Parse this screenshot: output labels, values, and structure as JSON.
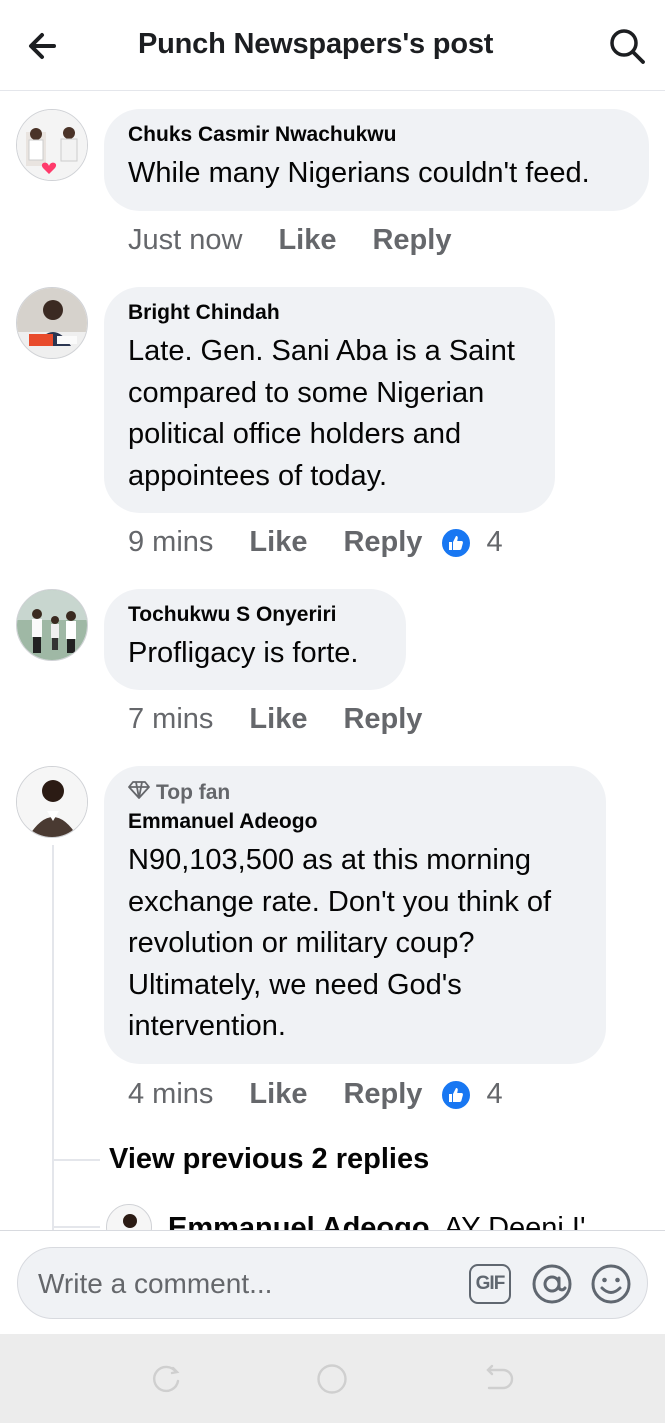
{
  "header": {
    "title": "Punch Newspapers's post",
    "back_icon": "arrow-left-icon",
    "search_icon": "search-icon"
  },
  "comments": [
    {
      "author": "Chuks Casmir Nwachukwu",
      "text": "While many Nigerians couldn't feed.",
      "time": "Just now",
      "like_label": "Like",
      "reply_label": "Reply"
    },
    {
      "author": "Bright Chindah",
      "text": "Late. Gen. Sani Aba is a Saint\ncompared to some Nigerian\npolitical office holders and\nappointees of today.",
      "time": "9 mins",
      "like_label": "Like",
      "reply_label": "Reply",
      "reaction_count": "4"
    },
    {
      "author": "Tochukwu S Onyeriri",
      "text": "Profligacy is forte.",
      "time": "7 mins",
      "like_label": "Like",
      "reply_label": "Reply"
    },
    {
      "badge": "Top fan",
      "author": "Emmanuel Adeogo",
      "text": "N90,103,500 as at this morning\nexchange rate. Don't you think of\nrevolution or military coup?\nUltimately, we need God's\nintervention.",
      "time": "4 mins",
      "like_label": "Like",
      "reply_label": "Reply",
      "reaction_count": "4"
    }
  ],
  "replies": {
    "view_previous_label": "View previous 2 replies",
    "peek_author": "Emmanuel Adeogo",
    "peek_text": "AY Deeni I'"
  },
  "composer": {
    "placeholder": "Write a comment...",
    "gif_label": "GIF"
  },
  "colors": {
    "accent": "#1877f2",
    "bubble": "#f0f2f5",
    "secondary_text": "#65676b"
  }
}
